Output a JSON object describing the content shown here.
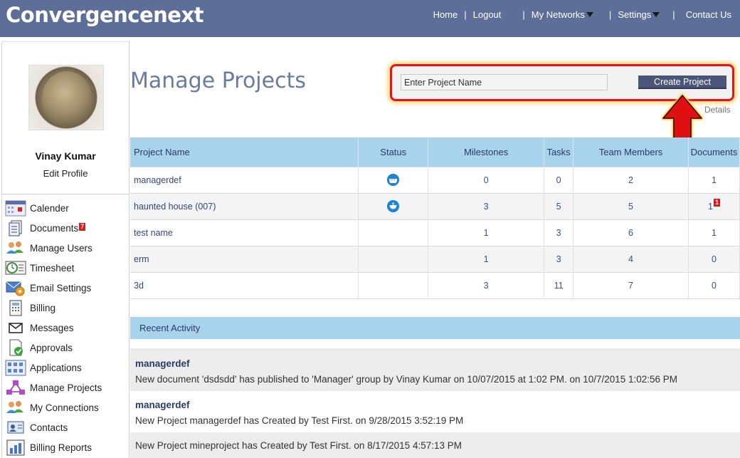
{
  "header": {
    "brand": "Convergencenext",
    "nav": {
      "home": "Home",
      "logout": "Logout",
      "my_networks": "My Networks",
      "settings": "Settings",
      "contact": "Contact Us",
      "sep": "|"
    }
  },
  "sidebar": {
    "user_name": "Vinay Kumar",
    "edit_profile": "Edit Profile",
    "items": [
      {
        "label": "Calender",
        "icon": "calendar-icon"
      },
      {
        "label": "Documents",
        "icon": "documents-icon",
        "badge": "7"
      },
      {
        "label": "Manage Users",
        "icon": "users-icon"
      },
      {
        "label": "Timesheet",
        "icon": "timesheet-icon"
      },
      {
        "label": "Email Settings",
        "icon": "email-settings-icon"
      },
      {
        "label": "Billing",
        "icon": "billing-icon"
      },
      {
        "label": "Messages",
        "icon": "messages-icon"
      },
      {
        "label": "Approvals",
        "icon": "approvals-icon"
      },
      {
        "label": "Applications",
        "icon": "applications-icon"
      },
      {
        "label": "Manage Projects",
        "icon": "projects-icon"
      },
      {
        "label": "My Connections",
        "icon": "connections-icon"
      },
      {
        "label": "Contacts",
        "icon": "contacts-icon"
      },
      {
        "label": "Billing Reports",
        "icon": "billing-reports-icon"
      }
    ]
  },
  "main": {
    "title": "Manage Projects",
    "project_input_placeholder": "Enter Project Name",
    "create_button": "Create Project",
    "details_link": "Details",
    "table": {
      "headers": [
        "Project Name",
        "Status",
        "Milestones",
        "Tasks",
        "Team Members",
        "Documents"
      ],
      "rows": [
        {
          "name": "managerdef",
          "status": "ship-icon",
          "milestones": "0",
          "tasks": "0",
          "team": "2",
          "documents": "1",
          "doc_badge": ""
        },
        {
          "name": "haunted house (007)",
          "status": "bowl-icon",
          "milestones": "3",
          "tasks": "5",
          "team": "5",
          "documents": "1",
          "doc_badge": "1"
        },
        {
          "name": "test name",
          "status": "",
          "milestones": "1",
          "tasks": "3",
          "team": "6",
          "documents": "1",
          "doc_badge": ""
        },
        {
          "name": "erm",
          "status": "",
          "milestones": "1",
          "tasks": "3",
          "team": "4",
          "documents": "0",
          "doc_badge": ""
        },
        {
          "name": "3d",
          "status": "",
          "milestones": "3",
          "tasks": "11",
          "team": "7",
          "documents": "0",
          "doc_badge": ""
        }
      ]
    },
    "recent_activity": {
      "heading": "Recent Activity",
      "items": [
        {
          "who": "managerdef",
          "text": "New document 'dsdsdd' has published to 'Manager' group by Vinay Kumar on 10/07/2015 at 1:02 PM. on 10/7/2015 1:02:56 PM"
        },
        {
          "who": "managerdef",
          "text": "New Project managerdef has Created by Test First. on 9/28/2015 3:52:19 PM"
        },
        {
          "who": "",
          "text": "New Project mineproject has Created by Test First. on 8/17/2015 4:57:13 PM"
        }
      ]
    }
  },
  "colors": {
    "header_bg": "#5d6e99",
    "table_header_bg": "#a7d3ec",
    "button_bg": "#4a5577",
    "highlight_border": "#e3151b",
    "badge": "#d91b1b"
  }
}
